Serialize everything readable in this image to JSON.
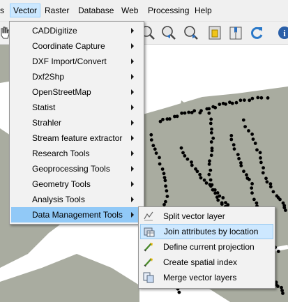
{
  "menubar": {
    "items": [
      {
        "label": "Vector",
        "active": true
      },
      {
        "label": "Raster"
      },
      {
        "label": "Database"
      },
      {
        "label": "Web"
      },
      {
        "label": "Processing"
      },
      {
        "label": "Help"
      }
    ]
  },
  "vector_menu": {
    "items": [
      {
        "label": "CADDigitize"
      },
      {
        "label": "Coordinate Capture"
      },
      {
        "label": "DXF Import/Convert"
      },
      {
        "label": "Dxf2Shp"
      },
      {
        "label": "OpenStreetMap"
      },
      {
        "label": "Statist"
      },
      {
        "label": "Strahler"
      },
      {
        "label": "Stream feature extractor"
      },
      {
        "label": "Research Tools"
      },
      {
        "label": "Geoprocessing Tools"
      },
      {
        "label": "Geometry Tools"
      },
      {
        "label": "Analysis Tools"
      },
      {
        "label": "Data Management Tools"
      }
    ]
  },
  "data_management_submenu": {
    "items": [
      {
        "label": "Split vector layer",
        "icon": "split-layer-icon"
      },
      {
        "label": "Join attributes by location",
        "icon": "join-attributes-icon"
      },
      {
        "label": "Define current projection",
        "icon": "define-projection-icon"
      },
      {
        "label": "Create spatial index",
        "icon": "spatial-index-icon"
      },
      {
        "label": "Merge vector layers",
        "icon": "merge-layers-icon"
      }
    ]
  },
  "colors": {
    "menu_highlight": "#91c9f7",
    "submenu_highlight": "#cde8ff",
    "map_land": "#a9aca0",
    "map_points": "#000000"
  }
}
